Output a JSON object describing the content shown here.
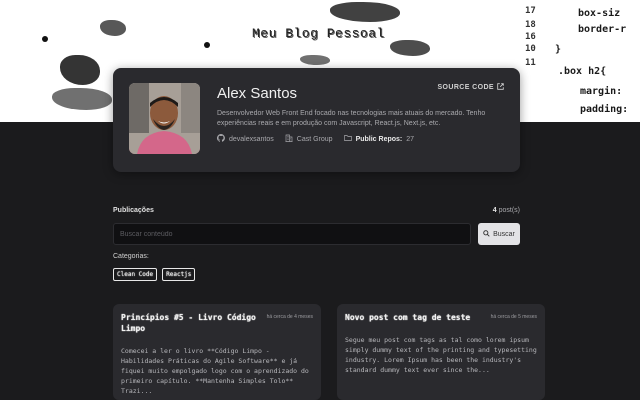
{
  "hero": {
    "title": "Meu Blog Pessoal",
    "code_lines": [
      "box-siz",
      "border-r",
      "}",
      ".box h2{",
      "margin:",
      "padding:"
    ],
    "line_numbers": [
      "17",
      "18",
      "16",
      "10",
      "11"
    ]
  },
  "profile": {
    "name": "Alex Santos",
    "source_code_label": "SOURCE CODE",
    "bio": "Desenvolvedor Web Front End focado nas tecnologias mais atuais do mercado. Tenho experiências reais e em produção com Javascript, React.js, Next.js, etc.",
    "github_user": "devalexsantos",
    "company": "Cast Group",
    "repos_label": "Public Repos:",
    "repos_count": "27"
  },
  "publications": {
    "title": "Publicações",
    "count_number": "4",
    "count_suffix": "post(s)",
    "search_placeholder": "Buscar conteúdo",
    "search_button_label": "Buscar",
    "categories_label": "Categorias:",
    "categories": [
      "Clean Code",
      "Reactjs"
    ]
  },
  "posts": [
    {
      "title": "Princípios #5 - Livro Código Limpo",
      "date": "há cerca de 4 meses",
      "excerpt": "Comecei a ler o livro **Código Limpo - Habilidades Práticas do Agile Software** e já fiquei muito empolgado logo com o aprendizado do primeiro capítulo. **Mantenha Simples Tolo** Trazi..."
    },
    {
      "title": "Novo post com tag de teste",
      "date": "há cerca de 5 meses",
      "excerpt": "Segue meu post com tags as tal como lorem ipsum simply dummy text of the printing and typesetting industry. Lorem Ipsum has been the industry's standard dummy text ever since the..."
    }
  ],
  "colors": {
    "background": "#1b1b1d",
    "card": "#2a2a2e",
    "hero": "#ffffff",
    "accent_text": "#f0f0f0"
  },
  "icons": {
    "source_code": "external-link-icon",
    "github": "github-icon",
    "company": "building-icon",
    "repos": "folder-icon",
    "search": "search-icon"
  }
}
